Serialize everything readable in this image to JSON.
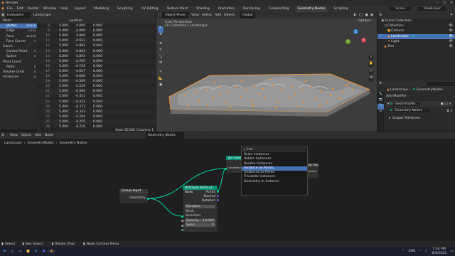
{
  "window": {
    "app_title": "Blender"
  },
  "menu": {
    "items": [
      "File",
      "Edit",
      "Render",
      "Window",
      "Help"
    ],
    "tabs": [
      "Layout",
      "Modeling",
      "Sculpting",
      "UV Editing",
      "Texture Paint",
      "Shading",
      "Animation",
      "Rendering",
      "Compositing",
      "Geometry Nodes",
      "Scripting"
    ],
    "active_tab": "Geometry Nodes",
    "scene_label": "Scene",
    "view_layer_label": "ViewLayer"
  },
  "spreadsheet": {
    "evaluated_label": "Evaluated",
    "object_label": "Landscape",
    "domains": [
      {
        "label": "Mesh",
        "count": ""
      },
      {
        "label": "Vertex",
        "count": "80,536"
      },
      {
        "label": "Edge",
        "count": "1,524"
      },
      {
        "label": "Face",
        "count": "80,536"
      },
      {
        "label": "Face Corner",
        "count": "0"
      },
      {
        "label": "Curve",
        "count": ""
      },
      {
        "label": "Control Point",
        "count": "0"
      },
      {
        "label": "Spline",
        "count": "0"
      },
      {
        "label": "Point Cloud",
        "count": ""
      },
      {
        "label": "Point",
        "count": "0"
      },
      {
        "label": "Volume Grids",
        "count": "0"
      },
      {
        "label": "Instances",
        "count": "0"
      }
    ],
    "column_header": "position",
    "rows": [
      [
        "8",
        "5.000",
        "4.000",
        "0.000"
      ],
      [
        "9",
        "5.000",
        "4.000",
        "0.000"
      ],
      [
        "10",
        "5.000",
        "4.000",
        "0.000"
      ],
      [
        "11",
        "5.000",
        "-4.922",
        "0.000"
      ],
      [
        "12",
        "5.000",
        "-4.882",
        "0.000"
      ],
      [
        "13",
        "5.000",
        "-4.843",
        "0.000"
      ],
      [
        "14",
        "5.000",
        "-4.804",
        "0.000"
      ],
      [
        "15",
        "5.000",
        "-4.765",
        "0.000"
      ],
      [
        "16",
        "5.000",
        "-4.725",
        "0.000"
      ],
      [
        "17",
        "5.000",
        "-4.647",
        "0.000"
      ],
      [
        "18",
        "5.000",
        "-4.608",
        "0.000"
      ],
      [
        "19",
        "5.000",
        "-4.569",
        "0.000"
      ],
      [
        "20",
        "5.000",
        "-4.529",
        "0.000"
      ],
      [
        "21",
        "5.000",
        "-4.490",
        "0.000"
      ],
      [
        "22",
        "5.000",
        "-4.451",
        "0.000"
      ],
      [
        "23",
        "5.000",
        "-4.412",
        "0.000"
      ],
      [
        "24",
        "5.000",
        "-4.373",
        "0.000"
      ],
      [
        "25",
        "5.000",
        "-4.333",
        "0.000"
      ],
      [
        "26",
        "5.000",
        "-4.294",
        "0.000"
      ],
      [
        "27",
        "5.000",
        "-4.255",
        "0.000"
      ],
      [
        "28",
        "5.000",
        "-4.216",
        "0.000"
      ],
      [
        "29",
        "5.000",
        "-4.176",
        "0.000"
      ]
    ],
    "status": "Rows: 80,536 | Columns: 1"
  },
  "viewport": {
    "mode_label": "Object Mode",
    "menu": [
      "View",
      "Select",
      "Add",
      "Object"
    ],
    "global_label": "Global",
    "overlay_title": "User Perspective",
    "overlay_sub": "(1) Collection | Landscape",
    "options_label": "Options"
  },
  "outliner": {
    "header": "Scene Collection",
    "items": [
      {
        "label": "Collection",
        "icon": "collection-icon"
      },
      {
        "label": "Camera",
        "icon": "camera-icon"
      },
      {
        "label": "Landscape",
        "icon": "mesh-icon"
      },
      {
        "label": "Light",
        "icon": "light-icon"
      },
      {
        "label": "Tree",
        "icon": "mesh-icon"
      }
    ]
  },
  "properties": {
    "object_label": "Landscape",
    "modifier_label": "GeometryNodes",
    "add_modifier_label": "Add Modifier",
    "modifier_name": "GeometryNo...",
    "node_group_label": "Geometry Nodes",
    "output_attributes_label": "Output Attributes"
  },
  "node_editor": {
    "menu": [
      "View",
      "Select",
      "Add",
      "Node"
    ],
    "tree_label": "Geometry Nodes",
    "breadcrumbs": [
      "Landscape",
      "GeometryNodes",
      "Geometry Nodes"
    ],
    "group_input": {
      "title": "Group Input",
      "geometry": "Geometry"
    },
    "group_output": {
      "title": "Group Output",
      "geometry": "Geometry"
    },
    "distribute": {
      "title": "Distribute Points on Faces",
      "mode": "Random",
      "mesh": "Mesh",
      "selection": "Selection",
      "density_label": "Density",
      "density_value": "10.000",
      "seed_label": "Seed",
      "seed_value": "0",
      "points": "Points",
      "normal": "Normal",
      "rotation": "Rotation"
    },
    "join": {
      "title": "Join Geometry",
      "geometry": "Geometry"
    },
    "search": {
      "query": "inst",
      "items": [
        "Scale Instances",
        "Rotate Instances",
        "Realize Instances",
        "Instance on Points",
        "Instances to Points",
        "Translate Instances",
        "Geometry to Instance"
      ],
      "highlight_index": 3
    }
  },
  "statusbar": {
    "items": [
      "Select",
      "Box Select",
      "Rotate View",
      "Node Context Menu"
    ]
  },
  "taskbar": {
    "time": "7:44 PM",
    "date": "6/4/2022",
    "lang": "ENG"
  },
  "colors": {
    "accent": "#4772b3",
    "geometry_socket": "#00d6a3",
    "vector_socket": "#6363c7",
    "float_socket": "#a1a1a1",
    "int_socket": "#598c5c",
    "distribute_header": "#0c8f77",
    "group_header": "#3b3b3b",
    "selection_orange": "#e8913a"
  }
}
